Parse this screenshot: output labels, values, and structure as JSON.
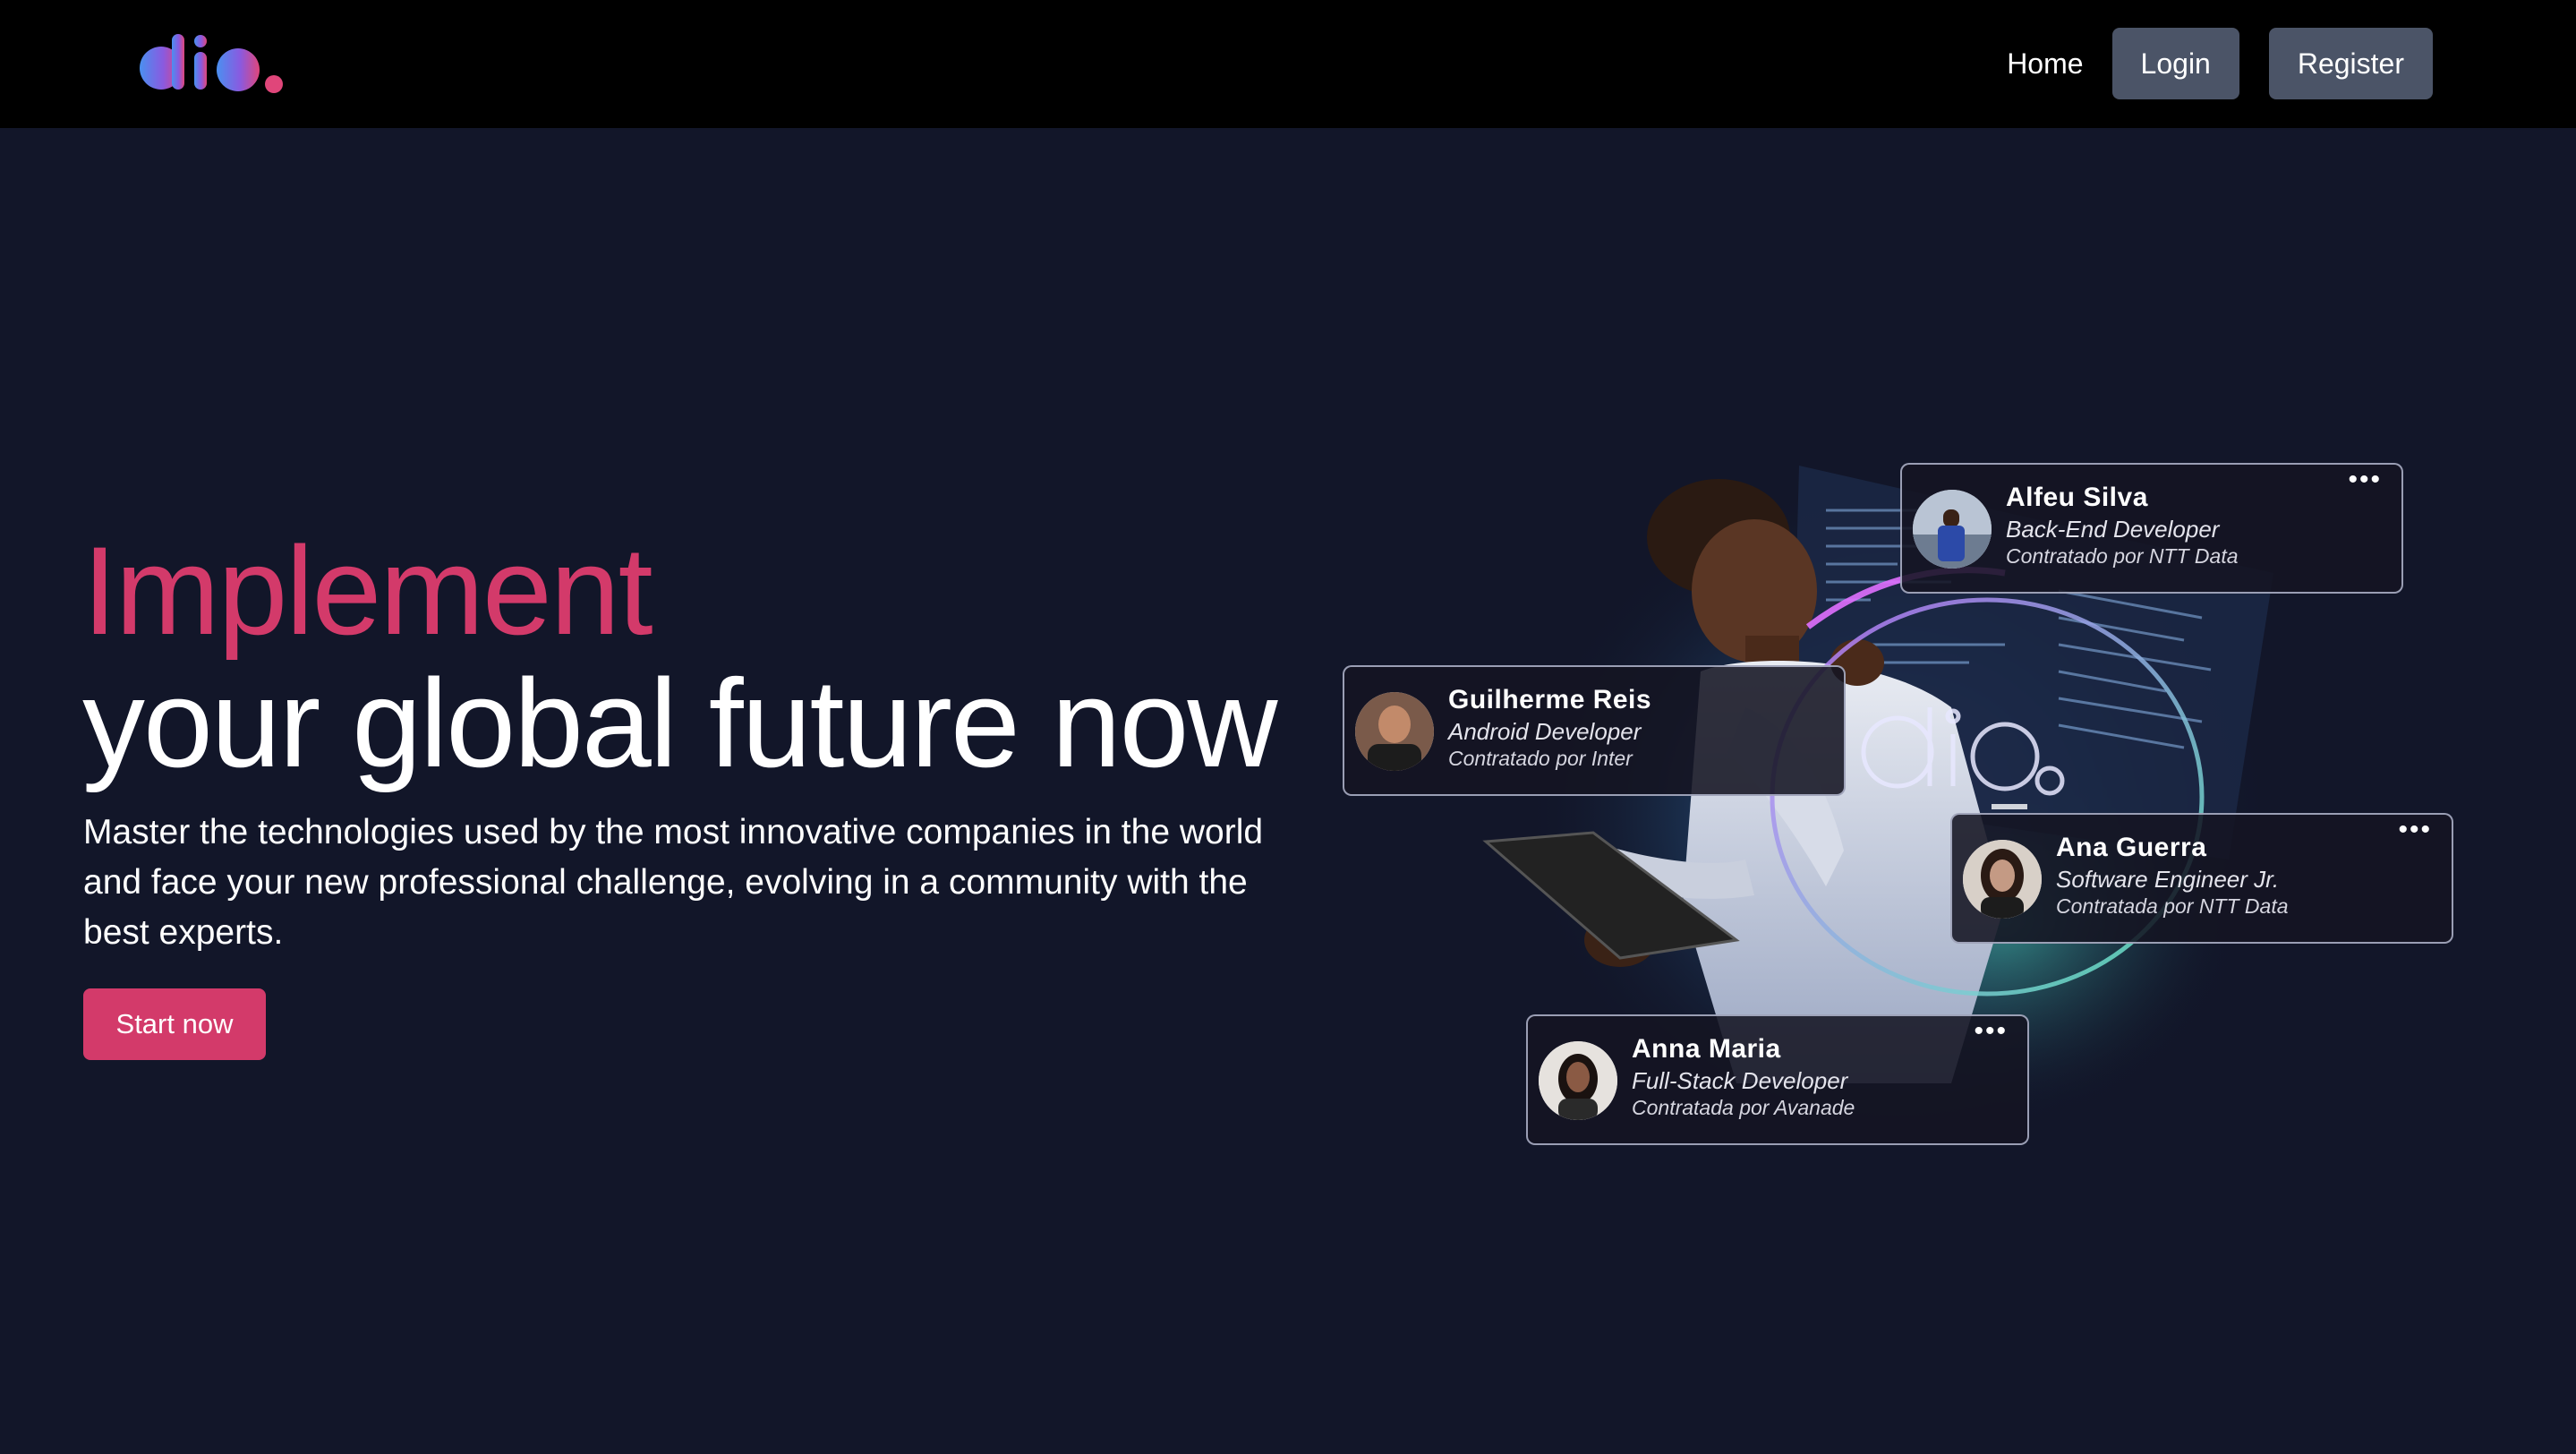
{
  "header": {
    "logo_text": "dio.",
    "nav": {
      "home": "Home",
      "login": "Login",
      "register": "Register"
    }
  },
  "hero": {
    "title_accent": "Implement",
    "title_main": "your global future now",
    "subtitle": "Master the technologies used by the most innovative companies in the world and face your new professional challenge, evolving in a community with the best experts.",
    "cta": "Start now"
  },
  "illustration": {
    "cards": [
      {
        "name": "Alfeu Silva",
        "role": "Back-End Developer",
        "hired": "Contratado por NTT Data",
        "menu": "•••"
      },
      {
        "name": "Guilherme Reis",
        "role": "Android Developer",
        "hired": "Contratado por Inter",
        "menu": ""
      },
      {
        "name": "Ana Guerra",
        "role": "Software Engineer Jr.",
        "hired": "Contratada por NTT Data",
        "menu": "•••"
      },
      {
        "name": "Anna Maria",
        "role": "Full-Stack Developer",
        "hired": "Contratada por Avanade",
        "menu": "•••"
      }
    ]
  },
  "colors": {
    "background": "#121629",
    "header": "#000000",
    "accent": "#d33a6a",
    "nav_button": "#4b5467"
  }
}
